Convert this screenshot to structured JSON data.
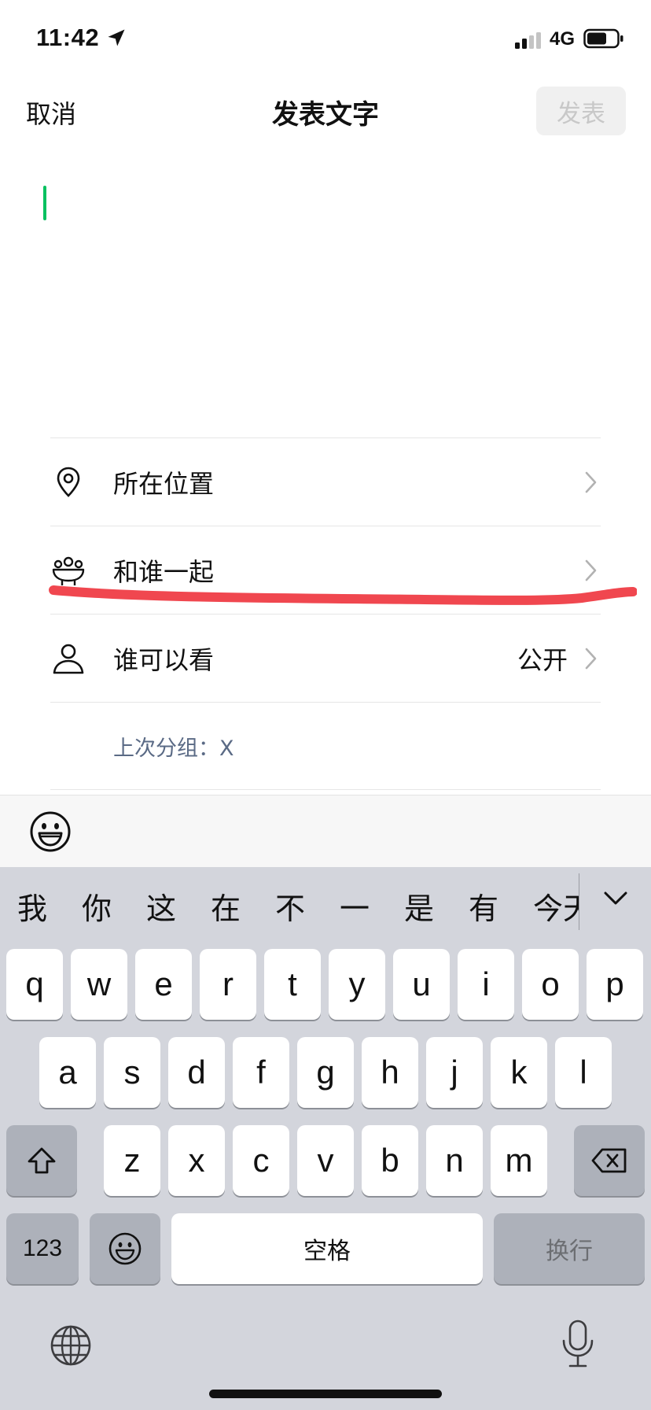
{
  "status": {
    "time": "11:42",
    "network": "4G"
  },
  "nav": {
    "cancel": "取消",
    "title": "发表文字",
    "publish": "发表"
  },
  "options": {
    "location": "所在位置",
    "with_who": "和谁一起",
    "visibility": "谁可以看",
    "visibility_value": "公开",
    "last_group": "上次分组：X"
  },
  "annotation": {
    "color": "#f0474f"
  },
  "keyboard": {
    "candidates": [
      "我",
      "你",
      "这",
      "在",
      "不",
      "一",
      "是",
      "有",
      "今天"
    ],
    "row1": [
      "q",
      "w",
      "e",
      "r",
      "t",
      "y",
      "u",
      "i",
      "o",
      "p"
    ],
    "row2": [
      "a",
      "s",
      "d",
      "f",
      "g",
      "h",
      "j",
      "k",
      "l"
    ],
    "row3": [
      "z",
      "x",
      "c",
      "v",
      "b",
      "n",
      "m"
    ],
    "numbers": "123",
    "space": "空格",
    "return": "换行"
  },
  "colors": {
    "accent": "#07c160",
    "keyboard_bg": "#d3d5dc"
  }
}
